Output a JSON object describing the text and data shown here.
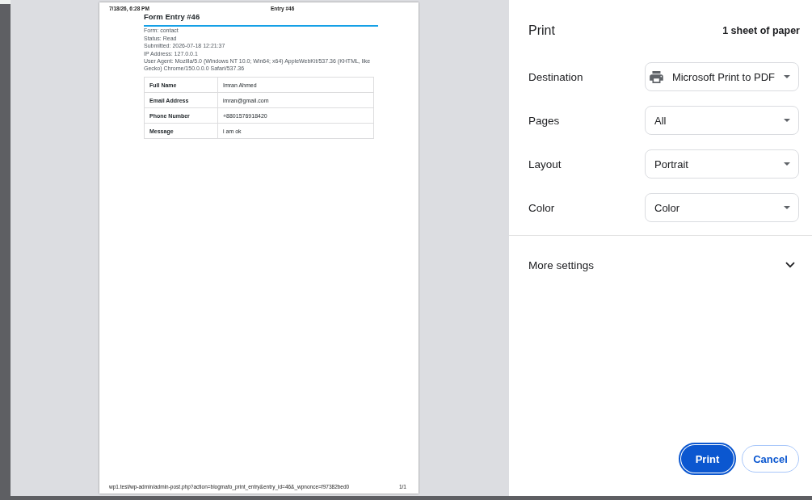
{
  "preview": {
    "page_header": {
      "date": "7/18/26, 6:28 PM",
      "title": "Entry #46"
    },
    "document": {
      "title": "Form Entry #46",
      "meta": [
        "Form: contact",
        "Status: Read",
        "Submitted: 2026-07-18 12:21:37",
        "IP Address: 127.0.0.1",
        "User Agent: Mozilla/5.0 (Windows NT 10.0; Win64; x64) AppleWebKit/537.36 (KHTML, like Gecko) Chrome/150.0.0.0 Safari/537.36"
      ],
      "table": {
        "rows": [
          {
            "field": "Full Name",
            "value": "Imran Ahmed"
          },
          {
            "field": "Email Address",
            "value": "imran@gmail.com"
          },
          {
            "field": "Phone Number",
            "value": "+8801576918420"
          },
          {
            "field": "Message",
            "value": "i am ok"
          }
        ]
      }
    },
    "page_footer": {
      "url": "wp1.test/wp-admin/admin-post.php?action=blogmafo_print_entry&entry_id=46&_wpnonce=f97382bed0",
      "page_number": "1/1"
    }
  },
  "panel": {
    "title": "Print",
    "sheet_count": "1 sheet of paper",
    "settings": [
      {
        "label": "Destination",
        "value": "Microsoft Print to PDF",
        "kind": "printer"
      },
      {
        "label": "Pages",
        "value": "All",
        "kind": "plain"
      },
      {
        "label": "Layout",
        "value": "Portrait",
        "kind": "plain"
      },
      {
        "label": "Color",
        "value": "Color",
        "kind": "plain"
      }
    ],
    "more_settings": {
      "label": "More settings",
      "expanded": false
    },
    "buttons": [
      {
        "label": "Print",
        "kind": "primary",
        "focused": true
      },
      {
        "label": "Cancel",
        "kind": "secondary",
        "focused": false
      }
    ]
  }
}
